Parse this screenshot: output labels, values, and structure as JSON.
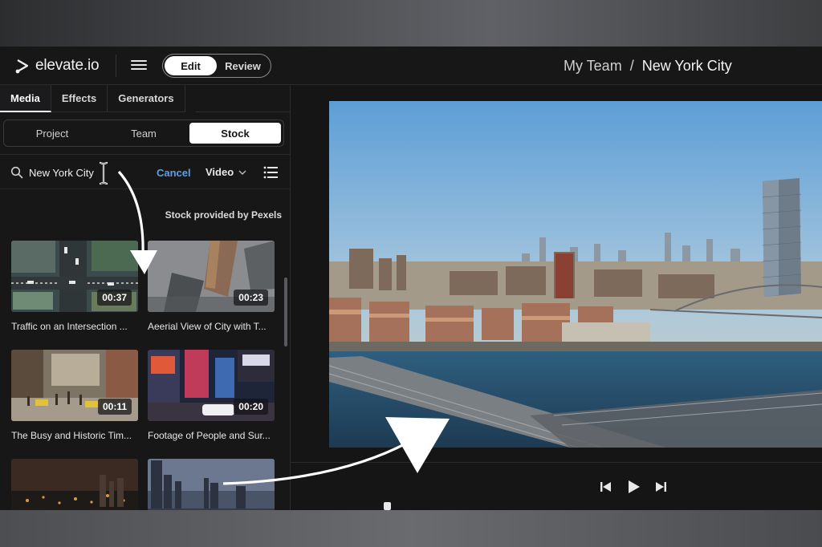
{
  "app": {
    "logo_text": "elevate.io",
    "mode_toggle": [
      {
        "label": "Edit",
        "active": true
      },
      {
        "label": "Review",
        "active": false
      }
    ],
    "breadcrumb": {
      "parent": "My Team",
      "separator": "/",
      "current": "New York City"
    }
  },
  "left_panel": {
    "tabs": [
      {
        "label": "Media",
        "active": true
      },
      {
        "label": "Effects",
        "active": false
      },
      {
        "label": "Generators",
        "active": false
      }
    ],
    "source_segments": [
      {
        "label": "Project",
        "active": false
      },
      {
        "label": "Team",
        "active": false
      },
      {
        "label": "Stock",
        "active": true
      }
    ],
    "search": {
      "value": "New York City",
      "cancel_label": "Cancel",
      "type_label": "Video"
    },
    "provided_by": "Stock provided by Pexels",
    "results": [
      {
        "title": "Traffic on an Intersection ...",
        "duration": "00:37"
      },
      {
        "title": "Aeerial View of City with T...",
        "duration": "00:23"
      },
      {
        "title": "The Busy and Historic Tim...",
        "duration": "00:11"
      },
      {
        "title": "Footage of People and Sur...",
        "duration": "00:20"
      },
      {
        "title": "",
        "duration": ""
      },
      {
        "title": "",
        "duration": ""
      }
    ]
  },
  "player": {
    "controls": [
      "skip-back-icon",
      "play-icon",
      "skip-forward-icon"
    ]
  },
  "colors": {
    "accent_link": "#5aa0e6",
    "bg": "#161617",
    "active_pill": "#ffffff"
  }
}
